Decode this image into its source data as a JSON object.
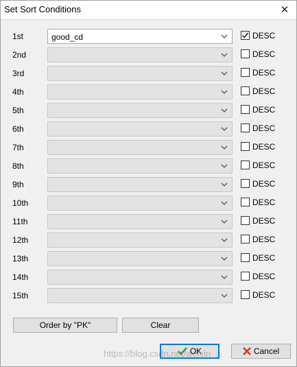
{
  "window": {
    "title": "Set Sort Conditions"
  },
  "rows": [
    {
      "rank": "1st",
      "field": "good_cd",
      "desc_label": "DESC",
      "desc_checked": true
    },
    {
      "rank": "2nd",
      "field": "",
      "desc_label": "DESC",
      "desc_checked": false
    },
    {
      "rank": "3rd",
      "field": "",
      "desc_label": "DESC",
      "desc_checked": false
    },
    {
      "rank": "4th",
      "field": "",
      "desc_label": "DESC",
      "desc_checked": false
    },
    {
      "rank": "5th",
      "field": "",
      "desc_label": "DESC",
      "desc_checked": false
    },
    {
      "rank": "6th",
      "field": "",
      "desc_label": "DESC",
      "desc_checked": false
    },
    {
      "rank": "7th",
      "field": "",
      "desc_label": "DESC",
      "desc_checked": false
    },
    {
      "rank": "8th",
      "field": "",
      "desc_label": "DESC",
      "desc_checked": false
    },
    {
      "rank": "9th",
      "field": "",
      "desc_label": "DESC",
      "desc_checked": false
    },
    {
      "rank": "10th",
      "field": "",
      "desc_label": "DESC",
      "desc_checked": false
    },
    {
      "rank": "11th",
      "field": "",
      "desc_label": "DESC",
      "desc_checked": false
    },
    {
      "rank": "12th",
      "field": "",
      "desc_label": "DESC",
      "desc_checked": false
    },
    {
      "rank": "13th",
      "field": "",
      "desc_label": "DESC",
      "desc_checked": false
    },
    {
      "rank": "14th",
      "field": "",
      "desc_label": "DESC",
      "desc_checked": false
    },
    {
      "rank": "15th",
      "field": "",
      "desc_label": "DESC",
      "desc_checked": false
    }
  ],
  "buttons": {
    "order_by_pk": "Order by \"PK\"",
    "clear": "Clear",
    "ok": "OK",
    "cancel": "Cancel"
  },
  "watermark": "https://blog.csdn.net/weixin_...",
  "colors": {
    "focus_border": "#0078d7",
    "ok_check": "#2f9e2f",
    "cancel_x": "#d23b3b"
  }
}
